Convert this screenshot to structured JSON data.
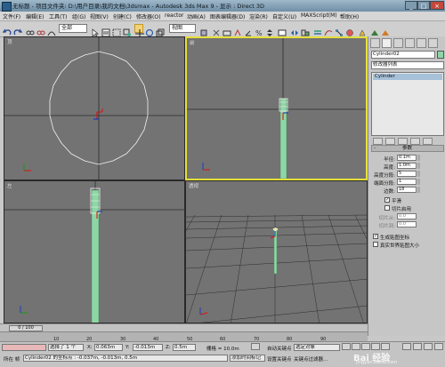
{
  "window": {
    "title": "无标题 - 项目文件夹: D:\\用户目录\\我的文档\\3dsmax - Autodesk 3ds Max 9 - 显示 : Direct 3D"
  },
  "menu": [
    "文件(F)",
    "编辑(E)",
    "工具(T)",
    "组(G)",
    "视图(V)",
    "创建(C)",
    "修改器(O)",
    "reactor",
    "动画(A)",
    "图表编辑器(D)",
    "渲染(R)",
    "自定义(U)",
    "MAXScript(M)",
    "帮助(H)"
  ],
  "toolbar": {
    "selection_filter": "全部",
    "coord_system": "视图"
  },
  "viewports": {
    "top_label": "顶",
    "front_label": "前",
    "left_label": "左",
    "persp_label": "透视"
  },
  "command_panel": {
    "object_name": "Cylinder02",
    "modifier_list": "修改器列表",
    "stack_item": "Cylinder",
    "rollout_title": "参数",
    "rollout_toggle": "-",
    "params": [
      {
        "label": "半径:",
        "value": "0.1m"
      },
      {
        "label": "高度:",
        "value": "1.0m"
      },
      {
        "label": "高度分段:",
        "value": "5"
      },
      {
        "label": "端面分段:",
        "value": "1"
      },
      {
        "label": "边数:",
        "value": "18"
      }
    ],
    "smooth_label": "平滑",
    "slice_on_label": "切片启用",
    "slice_from_label": "切片从:",
    "slice_to_label": "切片到:",
    "slice_from": "0.0",
    "slice_to": "0.0",
    "gen_mapping_label": "生成贴图坐标",
    "real_world_label": "真实世界贴图大小"
  },
  "timeline": {
    "frame": "0 / 100",
    "ticks": [
      "10",
      "20",
      "30",
      "40",
      "50",
      "60",
      "70",
      "80",
      "90"
    ]
  },
  "status": {
    "selected": "选择了 1 个",
    "x_label": "X:",
    "x_value": "0.063m",
    "y_label": "Y:",
    "y_value": "-0.013m",
    "z_label": "Z:",
    "z_value": "0.5m",
    "grid": "栅格 = 10.0m",
    "autokey": "自动关键点",
    "selected_obj": "选定对象",
    "set_key": "设置关键点",
    "key_filter": "关键点过滤器...",
    "prompt_label": "所在 帧",
    "prompt_text": "Cylinder02 的坐标点 : -0.037m, -0.013m, 0.5m",
    "add_time_tag": "添加时间标记"
  },
  "watermark": {
    "text": "Bai 经验",
    "url": "jingyan.baidu.com"
  },
  "colors": {
    "active_viewport": "#e6df3a",
    "viewport_bg": "#737373",
    "object_color": "#8fd6a6"
  }
}
